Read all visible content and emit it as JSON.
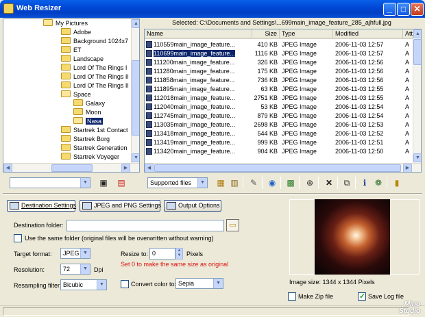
{
  "window": {
    "title": "Web Resizer",
    "buttons": {
      "minimize": "_",
      "maximize": "□",
      "close": "✕"
    }
  },
  "tree": {
    "root": "My Pictures",
    "items": [
      "Adobe",
      "Background 1024x7",
      "ET",
      "Landscape",
      "Lord Of The Rings I",
      "Lord Of The Rings II",
      "Lord Of The Rings II",
      "Space",
      "Galaxy",
      "Moon",
      "Nasa",
      "Startrek 1st Contact",
      "Startrek Borg",
      "Startrek Generation",
      "Startrek Voyeger"
    ]
  },
  "file_list": {
    "selected_path": "Selected: C:\\Documents and Settings\\...699main_image_feature_285_ajhfull.jpg",
    "columns": [
      "Name",
      "Size",
      "Type",
      "Modified",
      "Attr"
    ],
    "rows": [
      [
        "110559main_image_feature...",
        "410 KB",
        "JPEG Image",
        "2006-11-03 12:57",
        "A"
      ],
      [
        "110699main_image_feature...",
        "1116 KB",
        "JPEG Image",
        "2006-11-03 12:57",
        "A"
      ],
      [
        "111200main_image_feature...",
        "326 KB",
        "JPEG Image",
        "2006-11-03 12:56",
        "A"
      ],
      [
        "111280main_image_feature...",
        "175 KB",
        "JPEG Image",
        "2006-11-03 12:56",
        "A"
      ],
      [
        "111858main_image_feature...",
        "736 KB",
        "JPEG Image",
        "2006-11-03 12:56",
        "A"
      ],
      [
        "111895main_image_feature...",
        "63 KB",
        "JPEG Image",
        "2006-11-03 12:55",
        "A"
      ],
      [
        "112018main_image_feature...",
        "2751 KB",
        "JPEG Image",
        "2006-11-03 12:55",
        "A"
      ],
      [
        "112040main_image_feature...",
        "53 KB",
        "JPEG Image",
        "2006-11-03 12:54",
        "A"
      ],
      [
        "112745main_image_feature...",
        "879 KB",
        "JPEG Image",
        "2006-11-03 12:54",
        "A"
      ],
      [
        "113035main_image_feature...",
        "2698 KB",
        "JPEG Image",
        "2006-11-03 12:53",
        "A"
      ],
      [
        "113418main_image_feature...",
        "544 KB",
        "JPEG Image",
        "2006-11-03 12:52",
        "A"
      ],
      [
        "113419main_image_feature...",
        "999 KB",
        "JPEG Image",
        "2006-11-03 12:51",
        "A"
      ],
      [
        "113420main_image_feature...",
        "904 KB",
        "JPEG Image",
        "2006-11-03 12:50",
        "A"
      ]
    ]
  },
  "toolbar": {
    "drive_combo_value": "",
    "filter_combo_value": "Supported files"
  },
  "tabs": {
    "destination": "Destination Settings",
    "jpeg_png": "JPEG and PNG Settings",
    "output": "Output Options"
  },
  "settings": {
    "destination_folder_label": "Destination folder:",
    "destination_folder_value": "",
    "same_folder_label": "Use the same folder (original files will be overwritten without warning)",
    "target_format_label": "Target format:",
    "target_format_value": "JPEG",
    "resolution_label": "Resolution:",
    "resolution_value": "72",
    "resolution_unit": "Dpi",
    "resampling_label": "Resampling filter:",
    "resampling_value": "Bicubic",
    "resize_to_label": "Resize to:",
    "resize_to_value": "0",
    "resize_to_unit": "Pixels",
    "resize_hint": "Set 0 to make the same size as original",
    "convert_color_label": "Convert color to:",
    "convert_color_value": "Sepia"
  },
  "preview": {
    "image_size": "Image size: 1344 x 1344 Pixels",
    "make_zip_label": "Make Zip file",
    "make_zip_checked": false,
    "save_log_label": "Save Log file",
    "save_log_checked": true
  },
  "watermark": {
    "line1": "Mino",
    "line2": "Studio"
  },
  "colors": {
    "title_bar": "#0049d8",
    "selection": "#0a246a",
    "hint_text": "#dd1111"
  }
}
